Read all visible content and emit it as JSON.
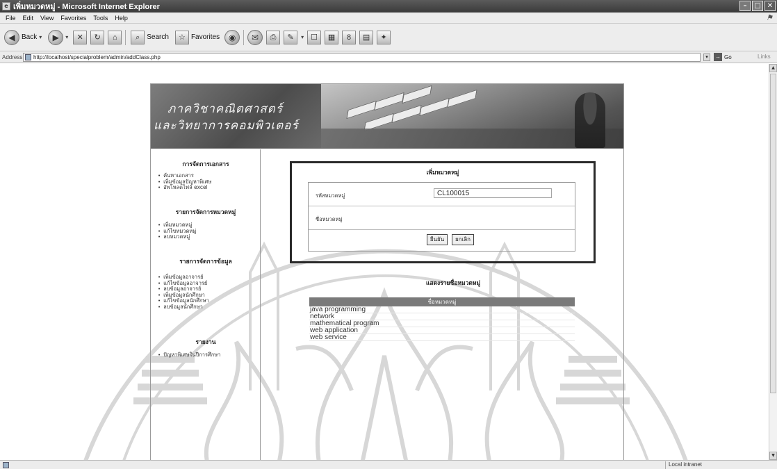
{
  "window": {
    "title": "เพิ่มหมวดหมู่ - Microsoft Internet Explorer",
    "controls": [
      "minimize",
      "maximize",
      "close"
    ]
  },
  "menu": [
    "File",
    "Edit",
    "View",
    "Favorites",
    "Tools",
    "Help"
  ],
  "toolbar": {
    "back_label": "Back",
    "search_label": "Search",
    "favorites_label": "Favorites",
    "icons": [
      "back-arrow-icon",
      "forward-arrow-icon",
      "stop-icon",
      "refresh-icon",
      "home-icon",
      "search-icon",
      "favorites-star-icon",
      "media-icon",
      "mail-icon",
      "print-icon",
      "edit-icon",
      "discuss-icon",
      "messenger-icon",
      "research-icon",
      "word-icon",
      "translate-icon"
    ]
  },
  "address": {
    "label": "Address",
    "url": "http://localhost/specialproblem/admin/addClass.php",
    "go_label": "Go",
    "links_label": "Links"
  },
  "banner": {
    "line1": "ภาควิชาคณิตศาสตร์",
    "line2": "และวิทยาการคอมพิวเตอร์"
  },
  "sidebar": {
    "sections": [
      {
        "title": "การจัดการเอกสาร",
        "items": [
          "ค้นหาเอกสาร",
          "เพิ่มข้อมูลปัญหาพิเศษ",
          "อัพโหลดไฟล์ excel"
        ]
      },
      {
        "title": "รายการจัดการหมวดหมู่",
        "items": [
          "เพิ่มหมวดหมู่",
          "แก้ไขหมวดหมู่",
          "ลบหมวดหมู่"
        ]
      },
      {
        "title": "รายการจัดการข้อมูล",
        "items": [
          "เพิ่มข้อมูลอาจารย์",
          "แก้ไขข้อมูลอาจารย์",
          "ลบข้อมูลอาจารย์",
          "เพิ่มข้อมูลนักศึกษา",
          "แก้ไขข้อมูลนักศึกษา",
          "ลบข้อมูลนักศึกษา"
        ]
      },
      {
        "title": "รายงาน",
        "items": [
          "ปัญหาพิเศษในปีการศึกษา"
        ]
      }
    ]
  },
  "form": {
    "title": "เพิ่มหมวดหมู่",
    "code_label": "รหัสหมวดหมู่",
    "code_value": "CL100015",
    "name_label": "ชื่อหมวดหมู่",
    "name_value": "",
    "confirm_label": "ยืนยัน",
    "cancel_label": "ยกเลิก"
  },
  "category_list": {
    "title": "แสดงรายชื่อหมวดหมู่",
    "header": "ชื่อหมวดหมู่",
    "rows": [
      "java programming",
      "network",
      "mathematical program",
      "web application",
      "web service"
    ]
  },
  "status": {
    "zone": "Local intranet"
  }
}
